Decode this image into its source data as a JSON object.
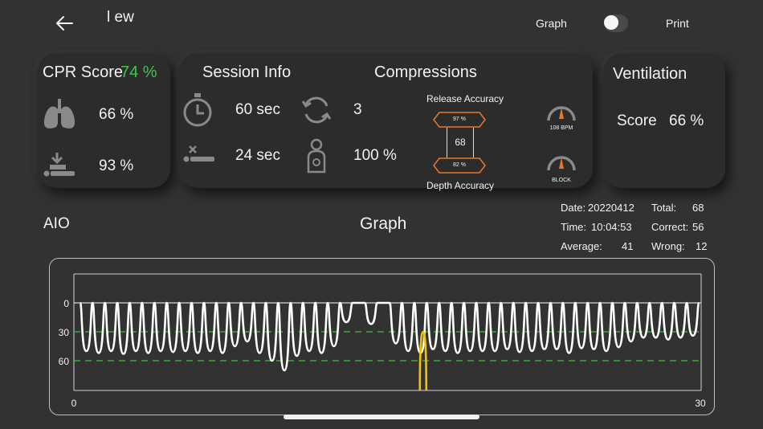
{
  "header": {
    "title": "l ew",
    "graph_label": "Graph",
    "print_label": "Print",
    "graph_toggle_on": false
  },
  "cpr": {
    "title": "CPR Score",
    "score": "74 %",
    "lungs_value": "66 %",
    "compression_value": "93 %"
  },
  "session": {
    "title": "Session Info",
    "time_value": "60 sec",
    "cycles_value": "3",
    "hands_off_value": "24 sec",
    "position_value": "100 %"
  },
  "compressions": {
    "title": "Compressions",
    "release_label": "Release Accuracy",
    "release_value": "97 %",
    "count_value": "68",
    "depth_value": "82 %",
    "depth_label": "Depth Accuracy",
    "rate_label": "108 BPM",
    "block_label": "BLOCK"
  },
  "ventilation": {
    "title": "Ventilation",
    "score_label": "Score",
    "score_value": "66 %"
  },
  "summary": {
    "mode": "AIO",
    "graph_title": "Graph",
    "date_label": "Date:",
    "date_value": "20220412",
    "time_label": "Time:",
    "time_value": "10:04:53",
    "average_label": "Average:",
    "average_value": "41",
    "total_label": "Total:",
    "total_value": "68",
    "correct_label": "Correct:",
    "correct_value": "56",
    "wrong_label": "Wrong:",
    "wrong_value": "12"
  },
  "chart_data": {
    "type": "line",
    "xlim": [
      0,
      30
    ],
    "ylim": [
      0,
      90
    ],
    "y_inverted": true,
    "x_tick_labels": [
      "0",
      "30"
    ],
    "y_tick_labels": [
      "0",
      "30",
      "60"
    ],
    "reference_lines": [
      30,
      60
    ],
    "colors": {
      "compression": "#ffffff",
      "ventilation": "#f2c300",
      "reference": "#3fbf3f",
      "baseline": "#ffffff"
    },
    "series": [
      {
        "depths": [
          50,
          52,
          50,
          53,
          50,
          52,
          50,
          51,
          50,
          52,
          50,
          52,
          45,
          40,
          52,
          60,
          70,
          55,
          50,
          52,
          45,
          20,
          "gap",
          22,
          "gap",
          42,
          50,
          52,
          48,
          50,
          52,
          50,
          50,
          50,
          48,
          51,
          50,
          48,
          48,
          52,
          47,
          48,
          50,
          46,
          40,
          36,
          36,
          38,
          36,
          34
        ],
        "x_start": 0.3,
        "x_end": 29.9
      },
      {
        "peak_x": 16.7,
        "peak_depth": 30
      }
    ]
  }
}
